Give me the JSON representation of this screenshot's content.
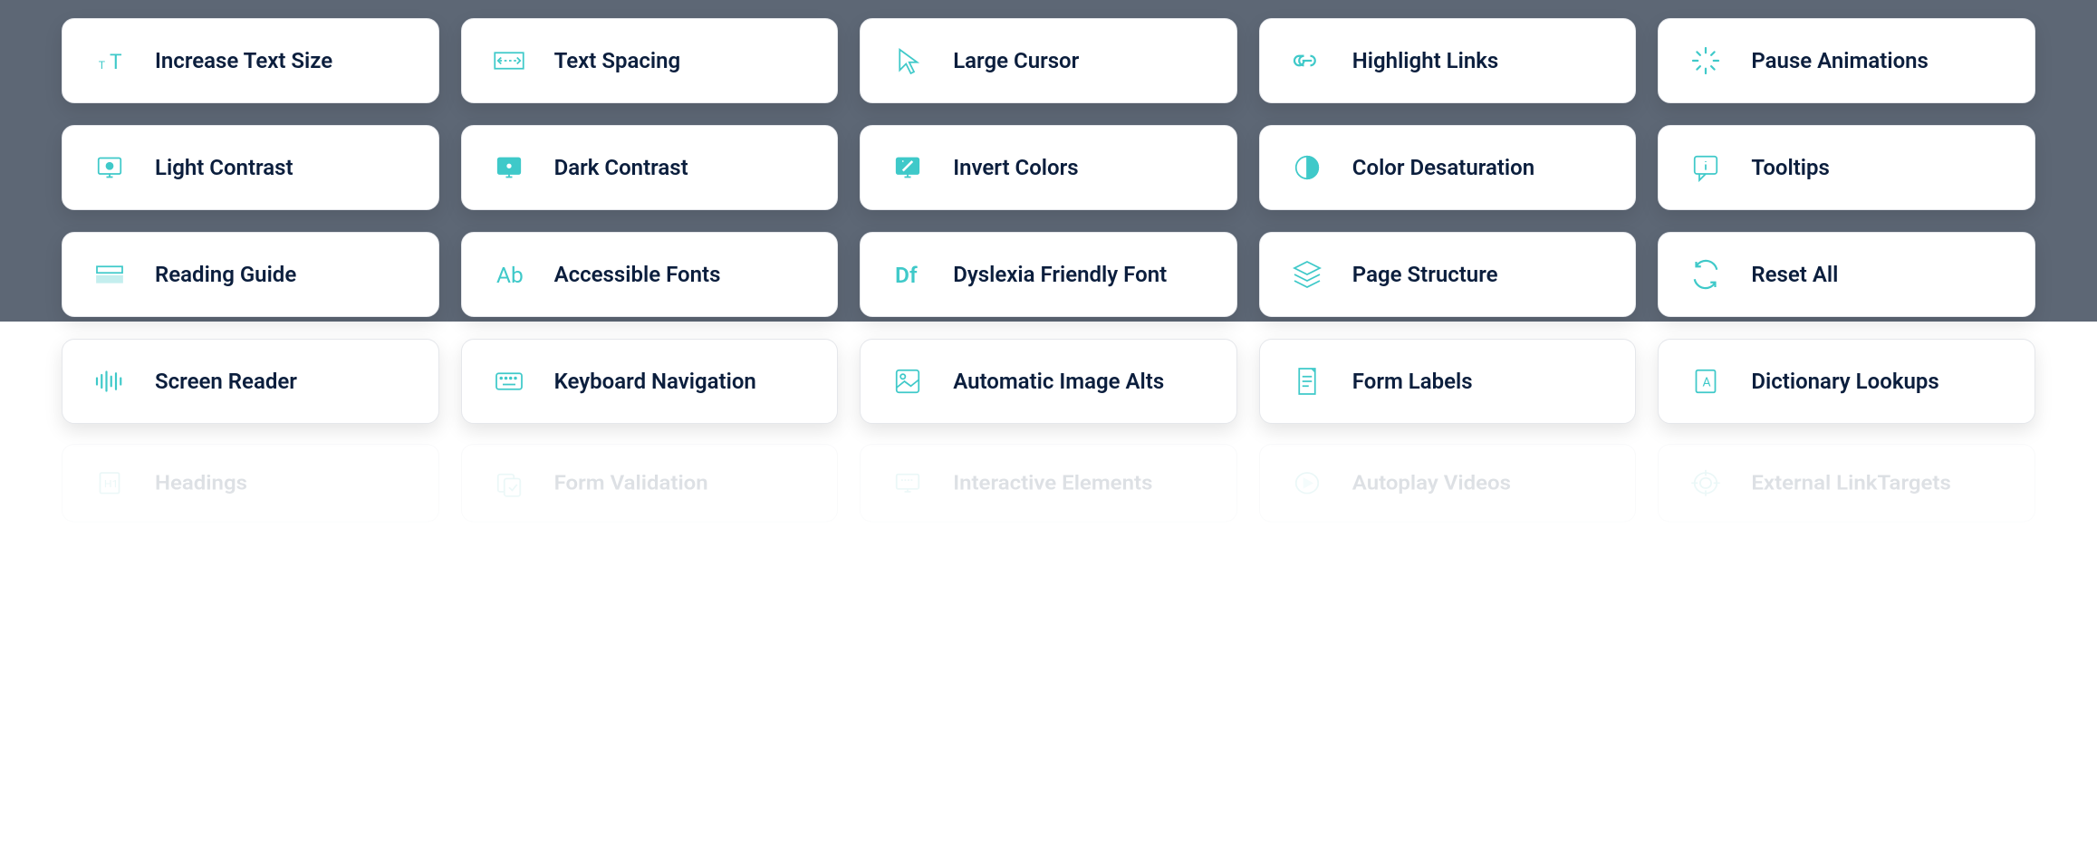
{
  "accent_color": "#3fc9c9",
  "text_color": "#0b1e3d",
  "cards": [
    {
      "label": "Increase Text Size",
      "icon": "text-size-icon"
    },
    {
      "label": "Text Spacing",
      "icon": "text-spacing-icon"
    },
    {
      "label": "Large Cursor",
      "icon": "cursor-icon"
    },
    {
      "label": "Highlight Links",
      "icon": "link-icon"
    },
    {
      "label": "Pause Animations",
      "icon": "pause-animation-icon"
    },
    {
      "label": "Light Contrast",
      "icon": "light-contrast-icon"
    },
    {
      "label": "Dark Contrast",
      "icon": "dark-contrast-icon"
    },
    {
      "label": "Invert Colors",
      "icon": "invert-colors-icon"
    },
    {
      "label": "Color Desaturation",
      "icon": "desaturation-icon"
    },
    {
      "label": "Tooltips",
      "icon": "tooltip-icon"
    },
    {
      "label": "Reading Guide",
      "icon": "reading-guide-icon"
    },
    {
      "label": "Accessible Fonts",
      "icon": "accessible-font-icon"
    },
    {
      "label": "Dyslexia Friendly Font",
      "icon": "dyslexia-font-icon"
    },
    {
      "label": "Page Structure",
      "icon": "layers-icon"
    },
    {
      "label": "Reset All",
      "icon": "reset-icon"
    },
    {
      "label": "Screen Reader",
      "icon": "audio-wave-icon"
    },
    {
      "label": "Keyboard Navigation",
      "icon": "keyboard-icon"
    },
    {
      "label": "Automatic Image Alts",
      "icon": "image-icon"
    },
    {
      "label": "Form Labels",
      "icon": "form-icon"
    },
    {
      "label": "Dictionary Lookups",
      "icon": "dictionary-icon"
    }
  ],
  "reflection_cards": [
    {
      "label": "Headings",
      "icon": "heading-icon"
    },
    {
      "label": "Form Validation",
      "icon": "validation-icon"
    },
    {
      "label": "Interactive Elements",
      "icon": "interactive-icon"
    },
    {
      "label": "Autoplay Videos",
      "icon": "autoplay-icon"
    },
    {
      "label": "External LinkTargets",
      "icon": "target-icon"
    }
  ]
}
